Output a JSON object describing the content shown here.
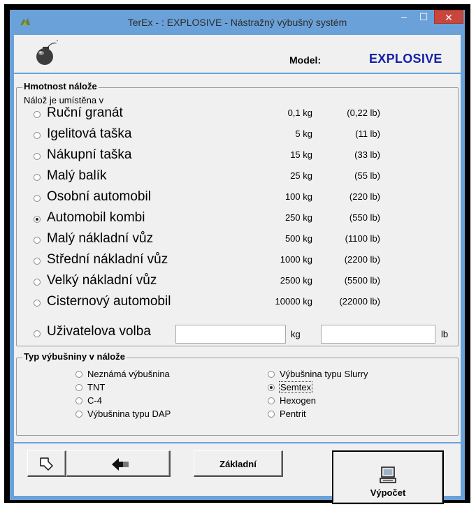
{
  "window": {
    "title": "TerEx - : EXPLOSIVE - Nástražný výbušný systém",
    "minimize_glyph": "–",
    "maximize_glyph": "☐",
    "close_glyph": "✕"
  },
  "header": {
    "model_label": "Model:",
    "model_value": "EXPLOSIVE",
    "model_color": "#1521a5"
  },
  "charge": {
    "legend": "Hmotnost nálože",
    "subtitle": "Nálož je umístěna v",
    "items": [
      {
        "label": "Ruční granát",
        "kg": "0,1 kg",
        "lb": "(0,22 lb)",
        "selected": false
      },
      {
        "label": "Igelitová taška",
        "kg": "5 kg",
        "lb": "(11 lb)",
        "selected": false
      },
      {
        "label": "Nákupní taška",
        "kg": "15 kg",
        "lb": "(33 lb)",
        "selected": false
      },
      {
        "label": "Malý balík",
        "kg": "25 kg",
        "lb": "(55 lb)",
        "selected": false
      },
      {
        "label": "Osobní automobil",
        "kg": "100 kg",
        "lb": "(220 lb)",
        "selected": false
      },
      {
        "label": "Automobil kombi",
        "kg": "250 kg",
        "lb": "(550 lb)",
        "selected": true
      },
      {
        "label": "Malý nákladní vůz",
        "kg": "500 kg",
        "lb": "(1100 lb)",
        "selected": false
      },
      {
        "label": "Střední nákladní vůz",
        "kg": "1000 kg",
        "lb": "(2200 lb)",
        "selected": false
      },
      {
        "label": "Velký nákladní vůz",
        "kg": "2500 kg",
        "lb": "(5500 lb)",
        "selected": false
      },
      {
        "label": "Cisternový automobil",
        "kg": "10000 kg",
        "lb": "(22000 lb)",
        "selected": false
      }
    ],
    "custom": {
      "label": "Uživatelova volba",
      "kg_value": "",
      "kg_unit": "kg",
      "lb_value": "",
      "lb_unit": "lb"
    }
  },
  "explosive": {
    "legend": "Typ výbušniny v nálože",
    "left": [
      {
        "label": "Neznámá výbušnina",
        "selected": false
      },
      {
        "label": "TNT",
        "selected": false
      },
      {
        "label": "C-4",
        "selected": false
      },
      {
        "label": "Výbušnina typu DAP",
        "selected": false
      }
    ],
    "right": [
      {
        "label": "Výbušnina typu Slurry",
        "selected": false
      },
      {
        "label": "Semtex",
        "selected": true
      },
      {
        "label": "Hexogen",
        "selected": false
      },
      {
        "label": "Pentrit",
        "selected": false
      }
    ]
  },
  "toolbar": {
    "reset_label": "Základní",
    "calculate_label": "Výpočet"
  }
}
